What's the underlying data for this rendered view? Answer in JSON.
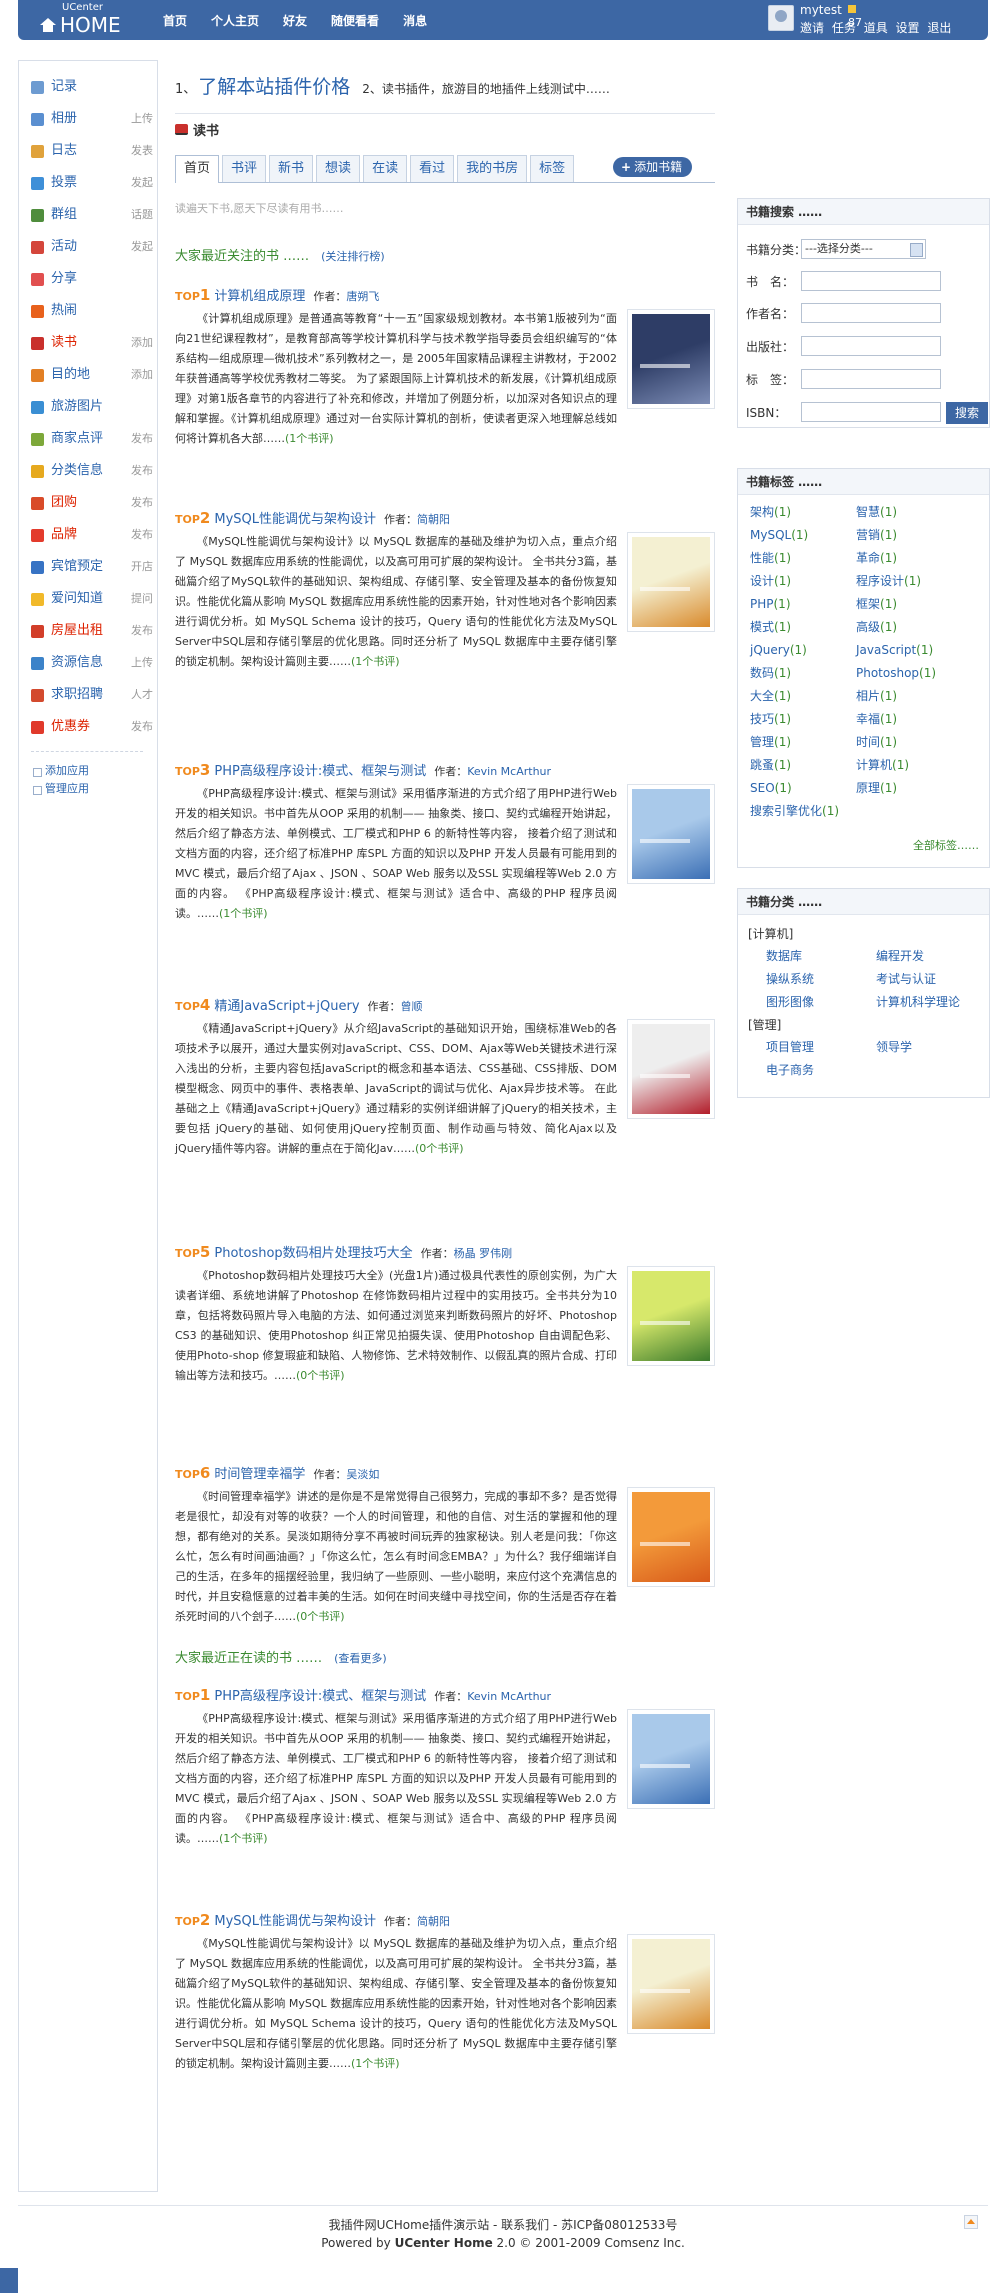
{
  "header": {
    "logo_small": "UCenter",
    "logo_big": "HOME",
    "nav": [
      "首页",
      "个人主页",
      "好友",
      "随便看看",
      "消息"
    ],
    "user": {
      "name": "mytest",
      "credit": "87",
      "links": [
        "邀请",
        "任务",
        "道具",
        "设置",
        "退出"
      ]
    }
  },
  "sidebar": {
    "apps": [
      {
        "name": "记录",
        "action": "",
        "icon_color": "#6d9bd1",
        "icon": "doodle-icon"
      },
      {
        "name": "相册",
        "action": "上传",
        "icon_color": "#5a8fd0",
        "icon": "photo-icon"
      },
      {
        "name": "日志",
        "action": "发表",
        "icon_color": "#e0a23b",
        "icon": "blog-icon"
      },
      {
        "name": "投票",
        "action": "发起",
        "icon_color": "#3e8fd8",
        "icon": "poll-icon"
      },
      {
        "name": "群组",
        "action": "话题",
        "icon_color": "#4f8d3c",
        "icon": "group-icon"
      },
      {
        "name": "活动",
        "action": "发起",
        "icon_color": "#d4463b",
        "icon": "event-icon"
      },
      {
        "name": "分享",
        "action": "",
        "icon_color": "#e14f4f",
        "icon": "share-icon"
      },
      {
        "name": "热闹",
        "action": "",
        "icon_color": "#e8611c",
        "icon": "hot-icon"
      },
      {
        "name": "读书",
        "action": "添加",
        "icon_color": "#c9302c",
        "icon": "book-icon",
        "active": true
      },
      {
        "name": "目的地",
        "action": "添加",
        "icon_color": "#e27f25",
        "icon": "destination-icon"
      },
      {
        "name": "旅游图片",
        "action": "",
        "icon_color": "#3a8ed3",
        "icon": "travel-icon"
      },
      {
        "name": "商家点评",
        "action": "发布",
        "icon_color": "#7da83a",
        "icon": "review-icon"
      },
      {
        "name": "分类信息",
        "action": "发布",
        "icon_color": "#e6a91e",
        "icon": "classified-icon"
      },
      {
        "name": "团购",
        "action": "发布",
        "icon_color": "#d94b29",
        "icon": "groupbuy-icon",
        "red": true
      },
      {
        "name": "品牌",
        "action": "发布",
        "icon_color": "#e33b2c",
        "icon": "brand-icon",
        "red": true
      },
      {
        "name": "宾馆预定",
        "action": "开店",
        "icon_color": "#3773c4",
        "icon": "hotel-icon"
      },
      {
        "name": "爱问知道",
        "action": "提问",
        "icon_color": "#f1b92a",
        "icon": "ask-icon"
      },
      {
        "name": "房屋出租",
        "action": "发布",
        "icon_color": "#d23e29",
        "icon": "house-icon",
        "red": true
      },
      {
        "name": "资源信息",
        "action": "上传",
        "icon_color": "#3c83c9",
        "icon": "resource-icon"
      },
      {
        "name": "求职招聘",
        "action": "人才",
        "icon_color": "#d34a2e",
        "icon": "job-icon"
      },
      {
        "name": "优惠券",
        "action": "发布",
        "icon_color": "#e0392b",
        "icon": "coupon-icon",
        "red": true
      }
    ],
    "footer_links": [
      "添加应用",
      "管理应用"
    ]
  },
  "main": {
    "promo_prefix": "1、",
    "promo_title": "了解本站插件价格",
    "promo_second": "2、读书插件，旅游目的地插件上线测试中……",
    "app_title": "读书",
    "tabs": [
      "首页",
      "书评",
      "新书",
      "想读",
      "在读",
      "看过",
      "我的书房",
      "标签"
    ],
    "add_button": "添加书籍",
    "slogan": "读遍天下书,愿天下尽读有用书……",
    "section1": {
      "title": "大家最近关注的书 ……",
      "more": "(关注排行榜)"
    },
    "section2": {
      "title": "大家最近正在读的书 ……",
      "more": "(查看更多)"
    },
    "author_label": "作者：",
    "books1": [
      {
        "rank": "1",
        "title": "计算机组成原理",
        "author": "唐朔飞",
        "cover": [
          "#2e3d66",
          "#7c8cb5"
        ],
        "desc": "《计算机组成原理》是普通高等教育“十一五”国家级规划教材。本书第1版被列为“面向21世纪课程教材”，是教育部高等学校计算机科学与技术教学指导委员会组织编写的“体系结构—组成原理—微机技术”系列教材之一，是 2005年国家精品课程主讲教材，于2002年获普通高等学校优秀教材二等奖。 为了紧跟国际上计算机技术的新发展，《计算机组成原理》对第1版各章节的内容进行了补充和修改，并增加了例题分析，以加深对各知识点的理解和掌握。《计算机组成原理》通过对一台实际计算机的剖析，使读者更深入地理解总线如何将计算机各大部……",
        "comments": "(1个书评)"
      },
      {
        "rank": "2",
        "title": "MySQL性能调优与架构设计",
        "author": "简朝阳",
        "cover": [
          "#f4f0d2",
          "#d98a2c"
        ],
        "desc": "《MySQL性能调优与架构设计》以 MySQL 数据库的基础及维护为切入点，重点介绍了 MySQL 数据库应用系统的性能调优，以及高可用可扩展的架构设计。 全书共分3篇，基础篇介绍了MySQL软件的基础知识、架构组成、存储引擎、安全管理及基本的备份恢复知识。性能优化篇从影响 MySQL 数据库应用系统性能的因素开始，针对性地对各个影响因素进行调优分析。如 MySQL Schema 设计的技巧，Query 语句的性能优化方法及MySQL Server中SQL层和存储引擎层的优化思路。同时还分析了 MySQL 数据库中主要存储引擎的锁定机制。架构设计篇则主要……",
        "comments": "(1个书评)"
      },
      {
        "rank": "3",
        "title": "PHP高级程序设计:模式、框架与测试",
        "author": "Kevin McArthur",
        "cover": [
          "#a9c9ea",
          "#3b6fb5"
        ],
        "desc": "《PHP高级程序设计:模式、框架与测试》采用循序渐进的方式介绍了用PHP进行Web 开发的相关知识。书中首先从OOP 采用的机制—— 抽象类、接口、契约式编程开始讲起，然后介绍了静态方法、单例模式、工厂模式和PHP 6 的新特性等内容， 接着介绍了测试和文档方面的内容，还介绍了标准PHP 库SPL 方面的知识以及PHP 开发人员最有可能用到的MVC 模式，最后介绍了Ajax 、JSON 、SOAP Web 服务以及SSL 实现编程等Web 2.0 方面的内容。 《PHP高级程序设计:模式、框架与测试》适合中、高级的PHP 程序员阅读。……",
        "comments": "(1个书评)"
      },
      {
        "rank": "4",
        "title": "精通JavaScript+jQuery",
        "author": "曾顺",
        "cover": [
          "#eeeeee",
          "#b21d2a"
        ],
        "desc": "《精通JavaScript+jQuery》从介绍JavaScript的基础知识开始，围绕标准Web的各项技术予以展开，通过大量实例对JavaScript、CSS、DOM、Ajax等Web关键技术进行深入浅出的分析，主要内容包括JavaScript的概念和基本语法、CSS基础、CSS排版、DOM模型概念、网页中的事件、表格表单、JavaScript的调试与优化、Ajax异步技术等。 在此基础之上《精通JavaScript+jQuery》通过精彩的实例详细讲解了jQuery的相关技术，主要包括 jQuery的基础、如何使用jQuery控制页面、制作动画与特效、简化Ajax以及jQuery插件等内容。讲解的重点在于简化Jav……",
        "comments": "(0个书评)"
      },
      {
        "rank": "5",
        "title": "Photoshop数码相片处理技巧大全",
        "author": "杨晶 罗伟刚",
        "cover": [
          "#d7e86b",
          "#3a7a2b"
        ],
        "desc": "《Photoshop数码相片处理技巧大全》(光盘1片)通过极具代表性的原创实例，为广大读者详细、系统地讲解了Photoshop 在修饰数码相片过程中的实用技巧。全书共分为10 章，包括将数码照片导入电脑的方法、如何通过浏览来判断数码照片的好坏、Photoshop CS3 的基础知识、使用Photoshop 纠正常见拍摄失误、使用Photoshop 自由调配色彩、使用Photo-shop 修复瑕疵和缺陷、人物修饰、艺术特效制作、以假乱真的照片合成、打印输出等方法和技巧。……",
        "comments": "(0个书评)"
      },
      {
        "rank": "6",
        "title": "时间管理幸福学",
        "author": "吴淡如",
        "cover": [
          "#f39a3a",
          "#d85a1a"
        ],
        "desc": "《时间管理幸福学》讲述的是你是不是常觉得自己很努力，完成的事却不多？是否觉得老是很忙，却没有对等的收获？一个人的时间管理，和他的自信、对生活的掌握和他的理想，都有绝对的关系。吴淡如期待分享不再被时间玩弄的独家秘诀。别人老是问我：「你这么忙，怎么有时间画油画？」「你这么忙，怎么有时间念EMBA？」为什么？我仔细端详自己的生活，在多年的摇摆经验里，我归纳了一些原则、一些小聪明，来应付这个充满信息的时代，并且安稳惬意的过着丰美的生活。如何在时间夹缝中寻找空间，你的生活是否存在着杀死时间的八个刽子……",
        "comments": "(0个书评)"
      }
    ],
    "books2": [
      {
        "rank": "1",
        "title": "PHP高级程序设计:模式、框架与测试",
        "author": "Kevin McArthur",
        "cover": [
          "#a9c9ea",
          "#3b6fb5"
        ],
        "desc": "《PHP高级程序设计:模式、框架与测试》采用循序渐进的方式介绍了用PHP进行Web 开发的相关知识。书中首先从OOP 采用的机制—— 抽象类、接口、契约式编程开始讲起，然后介绍了静态方法、单例模式、工厂模式和PHP 6 的新特性等内容， 接着介绍了测试和文档方面的内容，还介绍了标准PHP 库SPL 方面的知识以及PHP 开发人员最有可能用到的MVC 模式，最后介绍了Ajax 、JSON 、SOAP Web 服务以及SSL 实现编程等Web 2.0 方面的内容。 《PHP高级程序设计:模式、框架与测试》适合中、高级的PHP 程序员阅读。……",
        "comments": "(1个书评)"
      },
      {
        "rank": "2",
        "title": "MySQL性能调优与架构设计",
        "author": "简朝阳",
        "cover": [
          "#f4f0d2",
          "#d98a2c"
        ],
        "desc": "《MySQL性能调优与架构设计》以 MySQL 数据库的基础及维护为切入点，重点介绍了 MySQL 数据库应用系统的性能调优，以及高可用可扩展的架构设计。 全书共分3篇，基础篇介绍了MySQL软件的基础知识、架构组成、存储引擎、安全管理及基本的备份恢复知识。性能优化篇从影响 MySQL 数据库应用系统性能的因素开始，针对性地对各个影响因素进行调优分析。如 MySQL Schema 设计的技巧，Query 语句的性能优化方法及MySQL Server中SQL层和存储引擎层的优化思路。同时还分析了 MySQL 数据库中主要存储引擎的锁定机制。架构设计篇则主要……",
        "comments": "(1个书评)"
      }
    ]
  },
  "search_box": {
    "title": "书籍搜索 ……",
    "category_label": "书籍分类：",
    "category_value": "---选择分类---",
    "fields": [
      "书　名：",
      "作者名：",
      "出版社：",
      "标　签：",
      "ISBN："
    ],
    "button": "搜索"
  },
  "tags_box": {
    "title": "书籍标签 ……",
    "tags": [
      {
        "name": "架构",
        "count": "(1)"
      },
      {
        "name": "智慧",
        "count": "(1)"
      },
      {
        "name": "MySQL",
        "count": "(1)"
      },
      {
        "name": "营销",
        "count": "(1)"
      },
      {
        "name": "性能",
        "count": "(1)"
      },
      {
        "name": "革命",
        "count": "(1)"
      },
      {
        "name": "设计",
        "count": "(1)"
      },
      {
        "name": "程序设计",
        "count": "(1)"
      },
      {
        "name": "PHP",
        "count": "(1)"
      },
      {
        "name": "框架",
        "count": "(1)"
      },
      {
        "name": "模式",
        "count": "(1)"
      },
      {
        "name": "高级",
        "count": "(1)"
      },
      {
        "name": "jQuery",
        "count": "(1)"
      },
      {
        "name": "JavaScript",
        "count": "(1)"
      },
      {
        "name": "数码",
        "count": "(1)"
      },
      {
        "name": "Photoshop",
        "count": "(1)"
      },
      {
        "name": "大全",
        "count": "(1)"
      },
      {
        "name": "相片",
        "count": "(1)"
      },
      {
        "name": "技巧",
        "count": "(1)"
      },
      {
        "name": "幸福",
        "count": "(1)"
      },
      {
        "name": "管理",
        "count": "(1)"
      },
      {
        "name": "时间",
        "count": "(1)"
      },
      {
        "name": "跳蚤",
        "count": "(1)"
      },
      {
        "name": "计算机",
        "count": "(1)"
      },
      {
        "name": "SEO",
        "count": "(1)"
      },
      {
        "name": "原理",
        "count": "(1)"
      },
      {
        "name": "搜索引擎优化",
        "count": "(1)"
      }
    ],
    "all_tags": "全部标签……"
  },
  "category_box": {
    "title": "书籍分类 ……",
    "groups": [
      {
        "name": "[计算机]",
        "items": [
          "数据库",
          "编程开发",
          "操纵系统",
          "考试与认证",
          "图形图像",
          "计算机科学理论"
        ]
      },
      {
        "name": "[管理]",
        "items": [
          "项目管理",
          "领导学",
          "电子商务"
        ]
      }
    ]
  },
  "footer": {
    "line1": "我插件网UCHome插件演示站 - 联系我们 - 苏ICP备08012533号",
    "line2_prefix": "Powered by ",
    "line2_brand": "UCenter Home",
    "line2_suffix": " 2.0 © 2001-2009 Comsenz Inc."
  }
}
